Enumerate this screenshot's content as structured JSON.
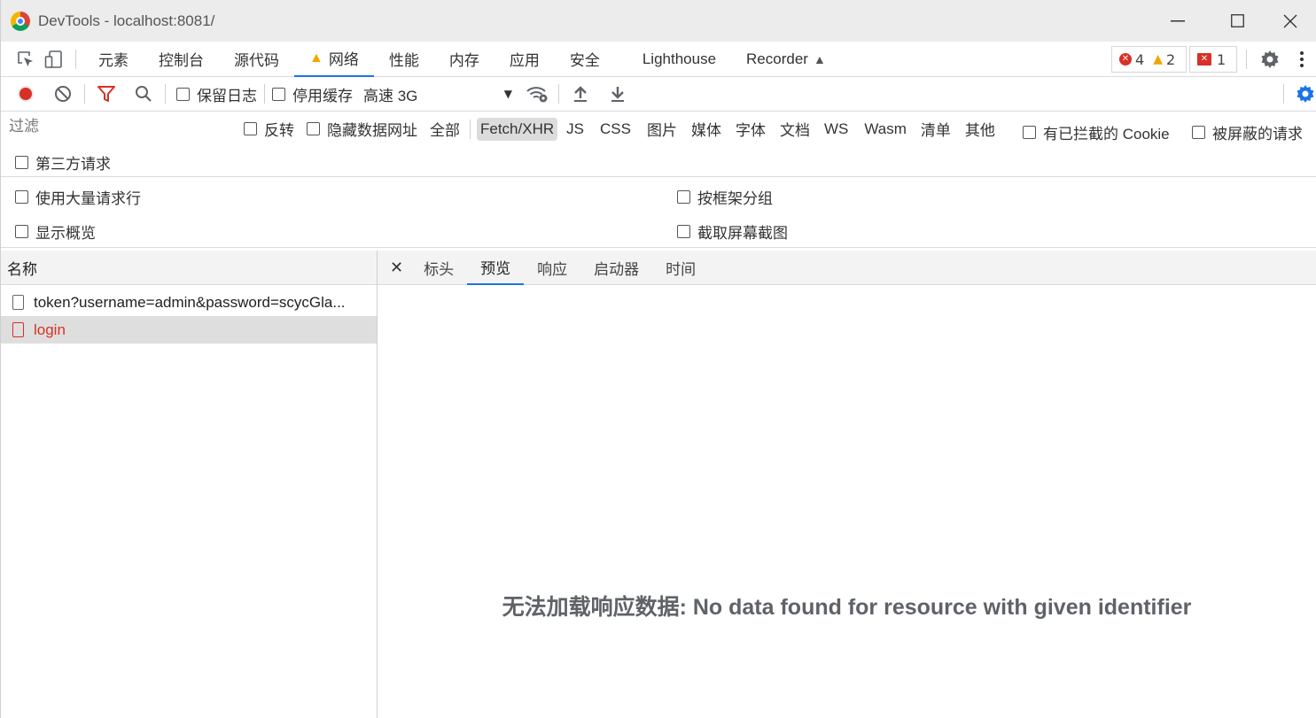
{
  "window": {
    "title": "DevTools - localhost:8081/"
  },
  "main_tabs": [
    {
      "label": "元素"
    },
    {
      "label": "控制台"
    },
    {
      "label": "源代码"
    },
    {
      "label": "网络"
    },
    {
      "label": "性能"
    },
    {
      "label": "内存"
    },
    {
      "label": "应用"
    },
    {
      "label": "安全"
    },
    {
      "label": "Lighthouse"
    },
    {
      "label": "Recorder"
    }
  ],
  "badges": {
    "errors": "4",
    "warnings": "2",
    "issues": "1"
  },
  "network_toolbar": {
    "preserve_log": "保留日志",
    "disable_cache": "停用缓存",
    "throttle": "高速 3G"
  },
  "filter": {
    "placeholder": "过滤",
    "invert": "反转",
    "hide_data_urls": "隐藏数据网址",
    "types": [
      "全部",
      "Fetch/XHR",
      "JS",
      "CSS",
      "图片",
      "媒体",
      "字体",
      "文档",
      "WS",
      "Wasm",
      "清单",
      "其他"
    ],
    "selected_type": "Fetch/XHR",
    "blocked_cookies": "有已拦截的 Cookie",
    "blocked_requests": "被屏蔽的请求",
    "third_party": "第三方请求"
  },
  "settings": {
    "big_rows": "使用大量请求行",
    "group_by_frame": "按框架分组",
    "show_overview": "显示概览",
    "capture_screenshots": "截取屏幕截图"
  },
  "requests": {
    "header": "名称",
    "items": [
      {
        "name": "token?username=admin&password=scycGla..."
      },
      {
        "name": "login",
        "status": "error"
      }
    ]
  },
  "detail": {
    "tabs": [
      "标头",
      "预览",
      "响应",
      "启动器",
      "时间"
    ],
    "active_tab": "预览",
    "message": "无法加载响应数据: No data found for resource with given identifier"
  },
  "colors": {
    "accent": "#1a73e8",
    "error": "#d93025",
    "record": "#d93025",
    "warning": "#f2a600"
  }
}
